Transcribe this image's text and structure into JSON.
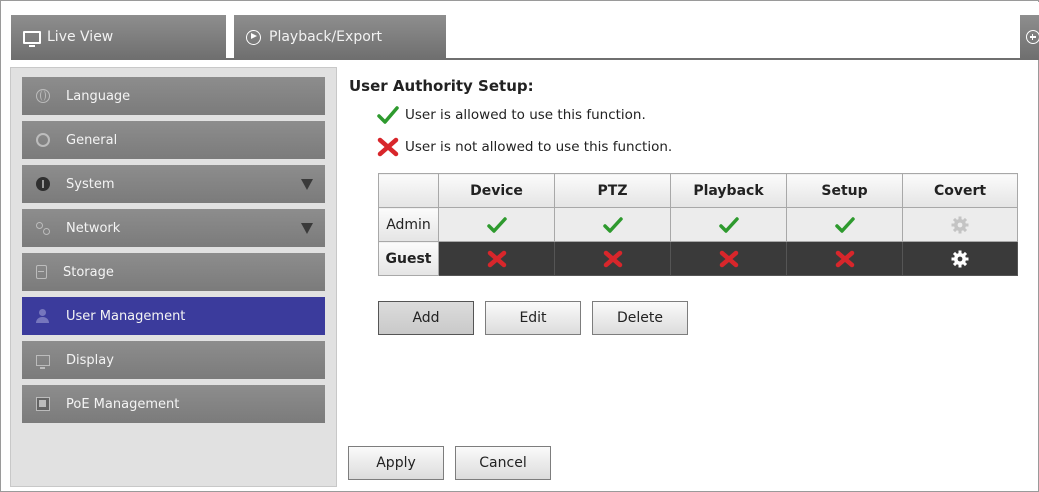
{
  "tabs": {
    "live_view": "Live View",
    "playback_export": "Playback/Export"
  },
  "sidebar": {
    "items": [
      {
        "label": "Language",
        "icon": "globe-icon",
        "expandable": false,
        "active": false
      },
      {
        "label": "General",
        "icon": "general-icon",
        "expandable": false,
        "active": false
      },
      {
        "label": "System",
        "icon": "info-icon",
        "expandable": true,
        "active": false
      },
      {
        "label": "Network",
        "icon": "network-icon",
        "expandable": true,
        "active": false
      },
      {
        "label": "Storage",
        "icon": "storage-icon",
        "expandable": false,
        "active": false
      },
      {
        "label": "User Management",
        "icon": "user-icon",
        "expandable": false,
        "active": true
      },
      {
        "label": "Display",
        "icon": "display-icon",
        "expandable": false,
        "active": false
      },
      {
        "label": "PoE Management",
        "icon": "poe-icon",
        "expandable": false,
        "active": false
      }
    ]
  },
  "main": {
    "title": "User Authority Setup:",
    "legend_allowed": "User is allowed to use this function.",
    "legend_denied": "User is not allowed to use this function.",
    "table": {
      "columns": [
        "Device",
        "PTZ",
        "Playback",
        "Setup",
        "Covert"
      ],
      "rows": [
        {
          "user": "Admin",
          "permissions": [
            "allowed",
            "allowed",
            "allowed",
            "allowed",
            "gear-disabled"
          ]
        },
        {
          "user": "Guest",
          "permissions": [
            "denied",
            "denied",
            "denied",
            "denied",
            "gear-enabled"
          ]
        }
      ]
    },
    "buttons": {
      "add": "Add",
      "edit": "Edit",
      "delete": "Delete",
      "apply": "Apply",
      "cancel": "Cancel"
    }
  },
  "colors": {
    "accent_active": "#3b3b9c",
    "allowed_check": "#2e9a2e",
    "denied_cross": "#d8262b",
    "guest_row": "#3a3a3a"
  }
}
